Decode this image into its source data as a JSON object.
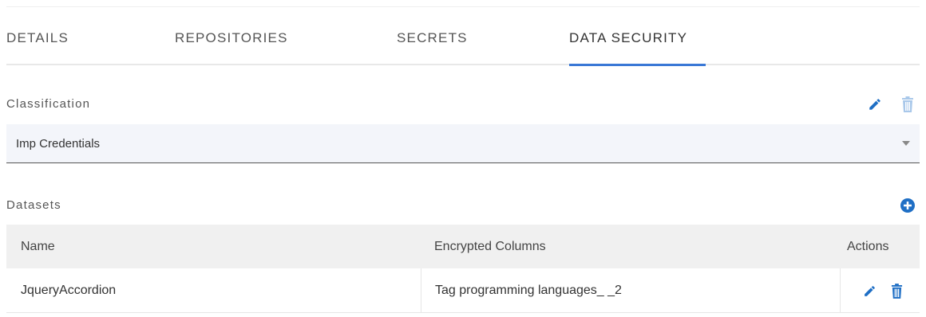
{
  "tabs": [
    {
      "label": "DETAILS",
      "active": false
    },
    {
      "label": "REPOSITORIES",
      "active": false
    },
    {
      "label": "SECRETS",
      "active": false
    },
    {
      "label": "DATA SECURITY",
      "active": true
    }
  ],
  "classification": {
    "label": "Classification",
    "selected_value": "Imp Credentials",
    "edit_icon": "pencil-icon",
    "delete_icon": "trash-icon"
  },
  "datasets": {
    "label": "Datasets",
    "add_icon": "plus-circle-icon",
    "columns": [
      "Name",
      "Encrypted Columns",
      "Actions"
    ],
    "rows": [
      {
        "name": "JqueryAccordion",
        "encrypted_columns": "Tag programming languages_ _2"
      }
    ]
  },
  "colors": {
    "accent": "#3a78d6",
    "icon_blue": "#1f6fc5",
    "icon_disabled": "#a9c8ea",
    "select_bg": "#f3f5fa",
    "header_bg": "#f0f0f0"
  }
}
